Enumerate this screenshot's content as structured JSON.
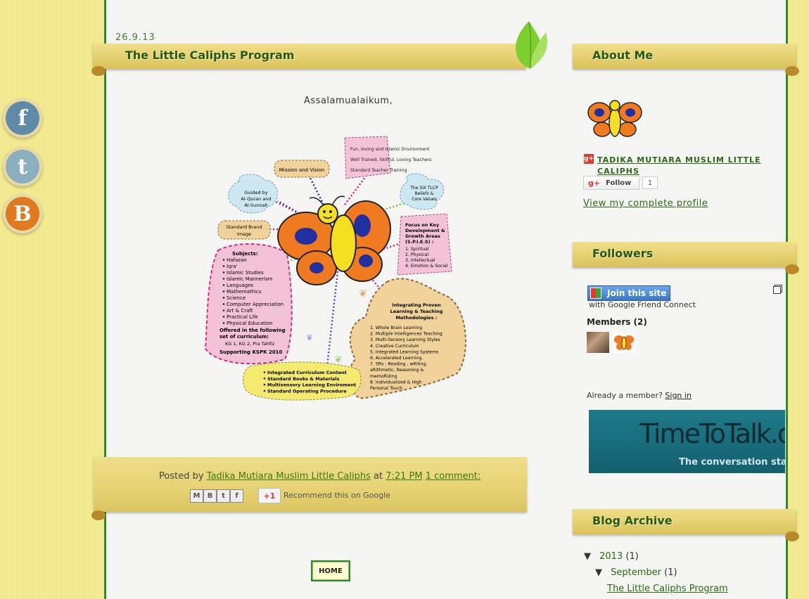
{
  "social": [
    {
      "name": "facebook",
      "glyph": "f",
      "color": "#5f8aa8"
    },
    {
      "name": "twitter",
      "glyph": "t",
      "color": "#8ab0c0"
    },
    {
      "name": "blogger",
      "glyph": "B",
      "color": "#e07a20"
    }
  ],
  "post": {
    "date": "26.9.13",
    "title": "The Little Caliphs Program",
    "greeting": "Assalamualaikum,",
    "image": {
      "bubbles": {
        "mission": "Mission and Vision",
        "fun": [
          "Fun, loving and Islamic Environment",
          "Well Trained, Skillful, Loving Teachers",
          "Standard Teacher Training"
        ],
        "six": [
          "The SIX TLCP",
          "Beliefs &",
          "Core Values"
        ],
        "guided": [
          "Guided by",
          "Al-Quran and",
          "Al-Sunnah"
        ],
        "brand": [
          "Standard Brand",
          "Image"
        ],
        "focus_title": [
          "Focus on Key",
          "Development &",
          "Growth Areas",
          "(S.P.I.E.S) :"
        ],
        "focus_items": [
          "1. Spiritual",
          "2. Physical",
          "3. Intellectual",
          "4. Emotion & Social"
        ],
        "subjects_title": "Subjects:",
        "subjects": [
          "Hafazan",
          "Iqra'",
          "Islamic Studies",
          "Islamic Mannerism",
          "Languages",
          "Mathemathics",
          "Science",
          "Computer Appreciation",
          "Art & Craft",
          "Practical Life",
          "Physical Education"
        ],
        "offered": [
          "Offered in the following",
          "set of curriculum:"
        ],
        "offered_item": "KG 1, KG 2, Pra Tahfiz",
        "supporting": "Supporting KSPK 2010",
        "integrating_title": [
          "Integrating Proven",
          "Learning & Teaching",
          "Methodologies :"
        ],
        "integrating": [
          "1. Whole Brain Learning",
          "2. Multiple Intelligences Teaching",
          "3. Multi-Sensory Learning Styles",
          "4. Creative Curriculum",
          "5. Integrated Learning Systems",
          "6. Accelerated Learning.",
          "7. 5Rs : Reading , wRiting,",
          "aRithmetic, Reasoning &",
          "memoRizing",
          "8. Individualized & High",
          "Personal Touch"
        ],
        "curriculum": [
          "Integrated Curriculum Content",
          "Standard Books & Materials",
          "Multisensory Learning Enviroment",
          "Standard Operating Procedure"
        ]
      }
    },
    "footer": {
      "posted_by": "Posted by",
      "author": "Tadika Mutiara Muslim Little Caliphs",
      "at": "at",
      "time": "7:21 PM",
      "comments": "1 comment:",
      "recommend": "Recommend this on Google",
      "plus_one": "+1",
      "share_icons": [
        "M",
        "B",
        "t",
        "f"
      ]
    }
  },
  "home_button": "HOME",
  "sidebar": {
    "about": {
      "title": "About Me",
      "name_line1": "TADIKA MUTIARA MUSLIM LITTLE",
      "name_line2": "CALIPHS",
      "follow": "Follow",
      "follow_count": "1",
      "view_profile": "View my complete profile"
    },
    "followers": {
      "title": "Followers",
      "join": "Join this site",
      "gfc": "with Google Friend Connect",
      "members": "Members (2)",
      "already": "Already a member?",
      "sign_in": "Sign in"
    },
    "banner": {
      "text": "TimeToTalk.or",
      "tagline": "The conversation star"
    },
    "archive": {
      "title": "Blog Archive",
      "year": "2013",
      "year_count": "(1)",
      "month": "September",
      "month_count": "(1)",
      "post": "The Little Caliphs Program"
    }
  }
}
